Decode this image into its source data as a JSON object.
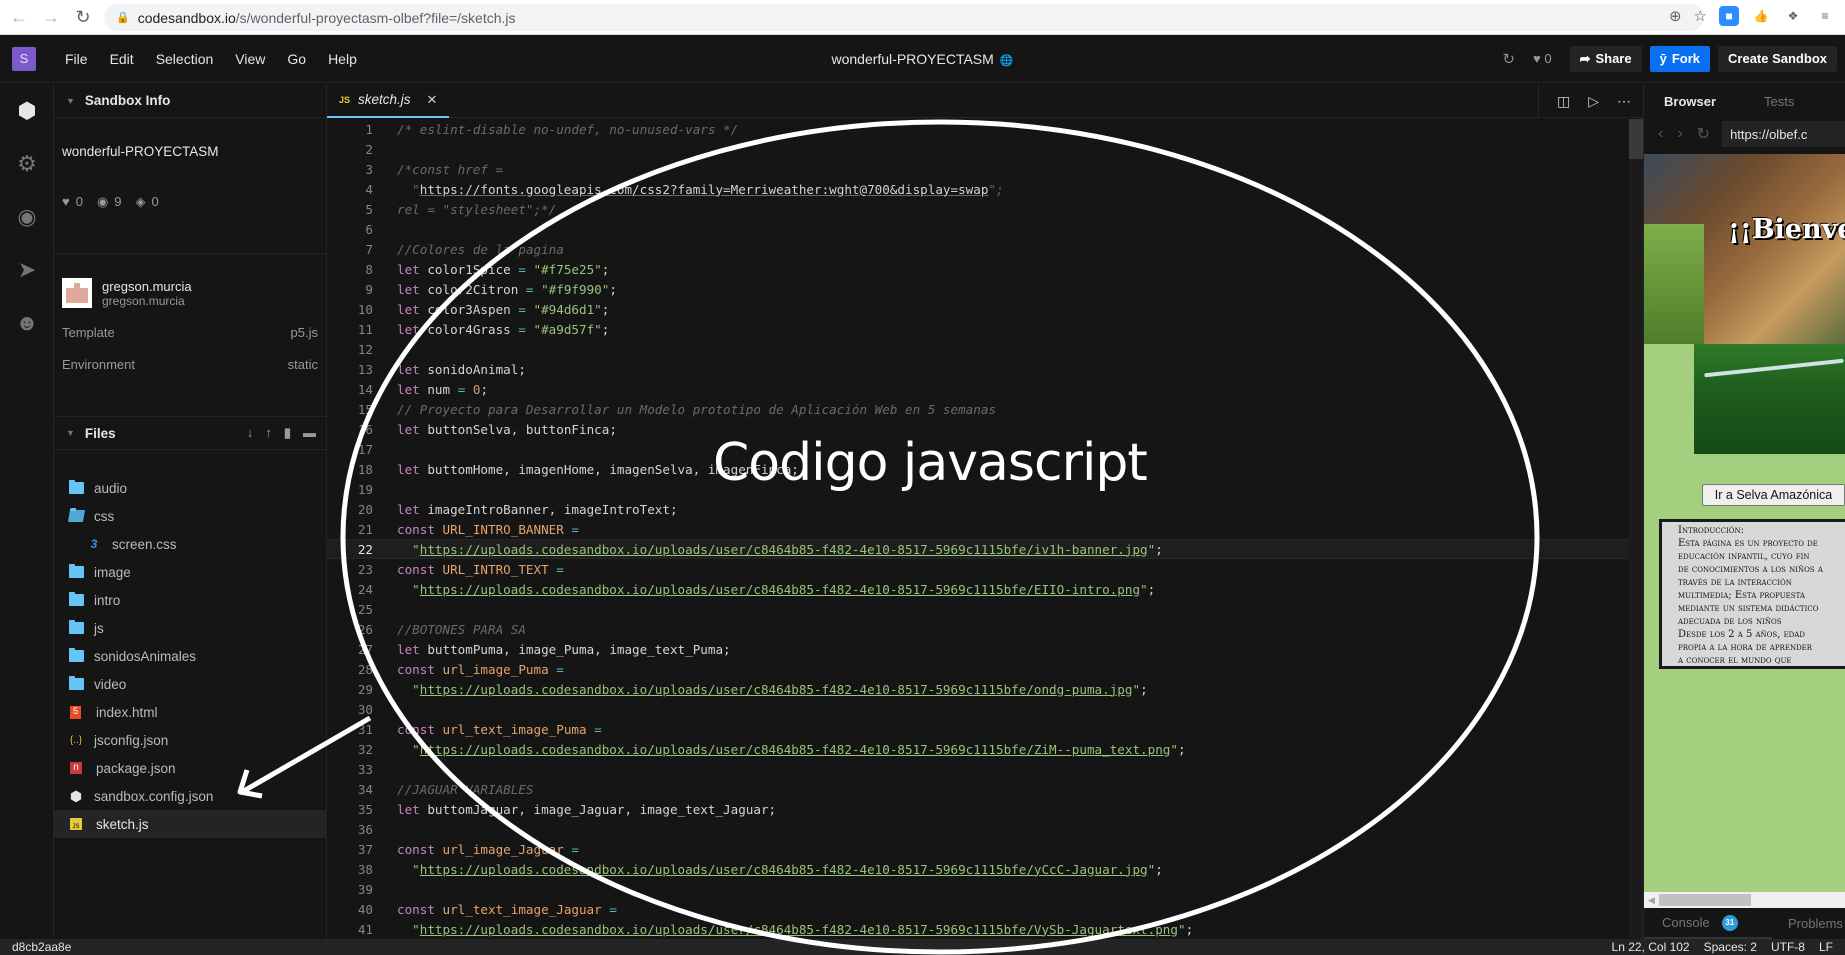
{
  "browser": {
    "url_host": "codesandbox.io",
    "url_path": "/s/wonderful-proyectasm-olbef?file=/sketch.js",
    "extensions": [
      "zoom-extension",
      "thumbs-up-extension",
      "puzzle-extensions",
      "reading-list"
    ]
  },
  "menubar": {
    "logo": "S",
    "items": [
      "File",
      "Edit",
      "Selection",
      "View",
      "Go",
      "Help"
    ],
    "title": "wonderful-PROYECTASM",
    "likes": "0",
    "share_label": "Share",
    "fork_label": "Fork",
    "create_label": "Create Sandbox"
  },
  "sidebar": {
    "sandbox_info_header": "Sandbox Info",
    "sandbox_name": "wonderful-PROYECTASM",
    "stats": {
      "likes": "0",
      "views": "9",
      "forks": "0"
    },
    "author": {
      "name": "gregson.murcia",
      "username": "gregson.murcia"
    },
    "template_label": "Template",
    "template_value": "p5.js",
    "environment_label": "Environment",
    "environment_value": "static",
    "files_header": "Files",
    "files": [
      {
        "name": "audio",
        "type": "folder"
      },
      {
        "name": "css",
        "type": "folder-open"
      },
      {
        "name": "screen.css",
        "type": "css"
      },
      {
        "name": "image",
        "type": "folder"
      },
      {
        "name": "intro",
        "type": "folder"
      },
      {
        "name": "js",
        "type": "folder"
      },
      {
        "name": "sonidosAnimales",
        "type": "folder"
      },
      {
        "name": "video",
        "type": "folder"
      },
      {
        "name": "index.html",
        "type": "html"
      },
      {
        "name": "jsconfig.json",
        "type": "json"
      },
      {
        "name": "package.json",
        "type": "npm"
      },
      {
        "name": "sandbox.config.json",
        "type": "sandbox"
      },
      {
        "name": "sketch.js",
        "type": "js",
        "active": true
      }
    ]
  },
  "editor": {
    "tab_label": "sketch.js",
    "tab_icon": "JS",
    "current_line": 22,
    "lines": [
      [
        [
          "c",
          "/* eslint-disable no-undef, no-unused-vars */"
        ]
      ],
      [],
      [
        [
          "c",
          "/*const href ="
        ]
      ],
      [
        [
          "c",
          "  \""
        ],
        [
          "cu",
          "https://fonts.googleapis.com/css2?family=Merriweather:wght@700&display=swap"
        ],
        [
          "c",
          "\";"
        ]
      ],
      [
        [
          "c",
          "rel = \"stylesheet\";*/"
        ]
      ],
      [],
      [
        [
          "c",
          "//Colores de la pagina"
        ]
      ],
      [
        [
          "k",
          "let "
        ],
        [
          "v",
          "color1Spice "
        ],
        [
          "o",
          "= "
        ],
        [
          "s",
          "\"#f75e25\""
        ],
        [
          "v",
          ";"
        ]
      ],
      [
        [
          "k",
          "let "
        ],
        [
          "v",
          "color2Citron "
        ],
        [
          "o",
          "= "
        ],
        [
          "s",
          "\"#f9f990\""
        ],
        [
          "v",
          ";"
        ]
      ],
      [
        [
          "k",
          "let "
        ],
        [
          "v",
          "color3Aspen "
        ],
        [
          "o",
          "= "
        ],
        [
          "s",
          "\"#94d6d1\""
        ],
        [
          "v",
          ";"
        ]
      ],
      [
        [
          "k",
          "let "
        ],
        [
          "v",
          "color4Grass "
        ],
        [
          "o",
          "= "
        ],
        [
          "s",
          "\"#a9d57f\""
        ],
        [
          "v",
          ";"
        ]
      ],
      [],
      [
        [
          "k",
          "let "
        ],
        [
          "v",
          "sonidoAnimal;"
        ]
      ],
      [
        [
          "k",
          "let "
        ],
        [
          "v",
          "num "
        ],
        [
          "o",
          "= "
        ],
        [
          "n",
          "0"
        ],
        [
          "v",
          ";"
        ]
      ],
      [
        [
          "c",
          "// Proyecto para Desarrollar un Modelo prototipo de Aplicación Web en 5 semanas"
        ]
      ],
      [
        [
          "k",
          "let "
        ],
        [
          "v",
          "buttonSelva, buttonFinca;"
        ]
      ],
      [],
      [
        [
          "k",
          "let "
        ],
        [
          "v",
          "buttomHome, imagenHome, imagenSelva, imagenFinca;"
        ]
      ],
      [],
      [
        [
          "k",
          "let "
        ],
        [
          "v",
          "imageIntroBanner, imageIntroText;"
        ]
      ],
      [
        [
          "k",
          "const "
        ],
        [
          "cn",
          "URL_INTRO_BANNER "
        ],
        [
          "o",
          "="
        ]
      ],
      [
        [
          "s",
          "  \""
        ],
        [
          "su",
          "https://uploads.codesandbox.io/uploads/user/c8464b85-f482-4e10-8517-5969c1115bfe/iv1h-banner.jpg"
        ],
        [
          "s",
          "\""
        ],
        [
          "v",
          ";"
        ]
      ],
      [
        [
          "k",
          "const "
        ],
        [
          "cn",
          "URL_INTRO_TEXT "
        ],
        [
          "o",
          "="
        ]
      ],
      [
        [
          "s",
          "  \""
        ],
        [
          "su",
          "https://uploads.codesandbox.io/uploads/user/c8464b85-f482-4e10-8517-5969c1115bfe/EIIO-intro.png"
        ],
        [
          "s",
          "\""
        ],
        [
          "v",
          ";"
        ]
      ],
      [],
      [
        [
          "c",
          "//BOTONES PARA SA"
        ]
      ],
      [
        [
          "k",
          "let "
        ],
        [
          "v",
          "buttomPuma, image_Puma, image_text_Puma;"
        ]
      ],
      [
        [
          "k",
          "const "
        ],
        [
          "cn",
          "url_image_Puma "
        ],
        [
          "o",
          "="
        ]
      ],
      [
        [
          "s",
          "  \""
        ],
        [
          "su",
          "https://uploads.codesandbox.io/uploads/user/c8464b85-f482-4e10-8517-5969c1115bfe/ondg-puma.jpg"
        ],
        [
          "s",
          "\""
        ],
        [
          "v",
          ";"
        ]
      ],
      [],
      [
        [
          "k",
          "const "
        ],
        [
          "cn",
          "url_text_image_Puma "
        ],
        [
          "o",
          "="
        ]
      ],
      [
        [
          "s",
          "  \""
        ],
        [
          "su",
          "https://uploads.codesandbox.io/uploads/user/c8464b85-f482-4e10-8517-5969c1115bfe/ZiM--puma_text.png"
        ],
        [
          "s",
          "\""
        ],
        [
          "v",
          ";"
        ]
      ],
      [],
      [
        [
          "c",
          "//JAGUAR VARIABLES"
        ]
      ],
      [
        [
          "k",
          "let "
        ],
        [
          "v",
          "buttomJaguar, image_Jaguar, image_text_Jaguar;"
        ]
      ],
      [],
      [
        [
          "k",
          "const "
        ],
        [
          "cn",
          "url_image_Jaguar "
        ],
        [
          "o",
          "="
        ]
      ],
      [
        [
          "s",
          "  \""
        ],
        [
          "su",
          "https://uploads.codesandbox.io/uploads/user/c8464b85-f482-4e10-8517-5969c1115bfe/yCcC-Jaguar.jpg"
        ],
        [
          "s",
          "\""
        ],
        [
          "v",
          ";"
        ]
      ],
      [],
      [
        [
          "k",
          "const "
        ],
        [
          "cn",
          "url_text_image_Jaguar "
        ],
        [
          "o",
          "="
        ]
      ],
      [
        [
          "s",
          "  \""
        ],
        [
          "su",
          "https://uploads.codesandbox.io/uploads/user/c8464b85-f482-4e10-8517-5969c1115bfe/VySb-Jaguartext.png"
        ],
        [
          "s",
          "\""
        ],
        [
          "v",
          ";"
        ]
      ]
    ]
  },
  "annotation": {
    "label": "Codigo javascript"
  },
  "preview": {
    "tab_browser": "Browser",
    "tab_tests": "Tests",
    "url": "https://olbef.c",
    "welcome_text": "¡¡Bienvenidos",
    "button_label": "Ir a Selva Amazónica",
    "intro_lines": [
      "Introducción:",
      "Esta página es un proyecto de",
      "educación infantil, cuyo fin",
      "de conocimientos a los niños a",
      "través de la interacción",
      "multimedia; Esta propuesta",
      "mediante un sistema didáctico",
      "adecuada de los niños",
      "Desde los 2 a 5 años, edad",
      "propia a la hora de aprender",
      "a conocer el mundo que"
    ],
    "console_label": "Console",
    "console_count": "31",
    "problems_label": "Problems"
  },
  "statusbar": {
    "hash": "d8cb2aa8e",
    "position": "Ln 22, Col 102",
    "spaces": "Spaces: 2",
    "encoding": "UTF-8",
    "eol": "LF"
  }
}
